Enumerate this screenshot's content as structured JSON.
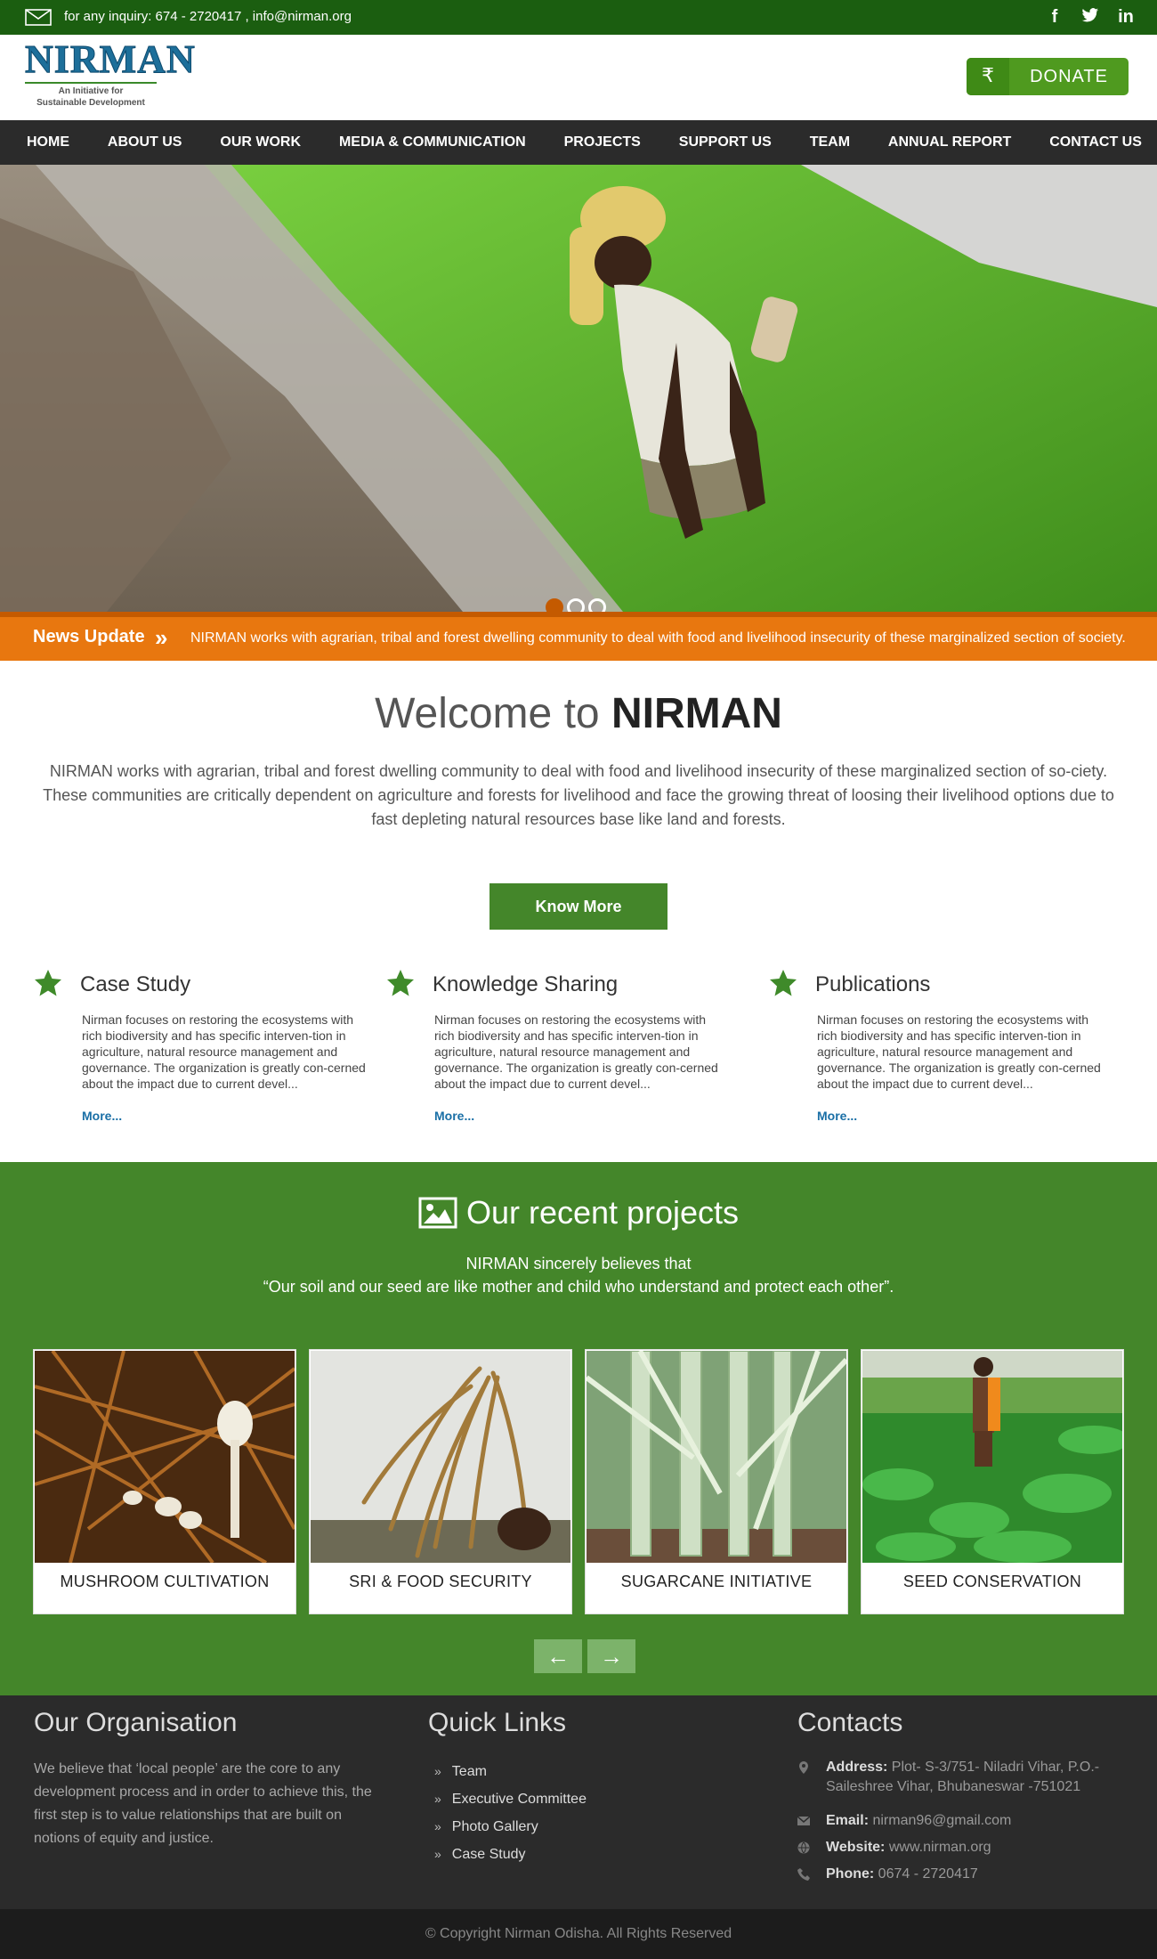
{
  "topbar": {
    "inquiry": "for any inquiry: 674 - 2720417 , info@nirman.org",
    "social": [
      "facebook-icon",
      "twitter-icon",
      "linkedin-icon"
    ]
  },
  "logo": {
    "brand": "NIRMAN",
    "tagline_1": "An Initiative for",
    "tagline_2": "Sustainable Development"
  },
  "donate": {
    "symbol": "₹",
    "label": "DONATE"
  },
  "nav": {
    "items": [
      "HOME",
      "ABOUT US",
      "OUR WORK",
      "MEDIA & COMMUNICATION",
      "PROJECTS",
      "SUPPORT US",
      "TEAM",
      "ANNUAL REPORT",
      "CONTACT US"
    ]
  },
  "hero": {
    "slides": 3,
    "active_slide": 1
  },
  "news": {
    "title": "News Update",
    "ticker": "NIRMAN works with agrarian, tribal and forest dwelling community to deal with food and livelihood insecurity of these marginalized section of society."
  },
  "welcome": {
    "title_prefix": "Welcome to ",
    "title_brand": "NIRMAN",
    "text": "NIRMAN works with agrarian, tribal and forest dwelling community to deal with food and livelihood insecurity of these marginalized section of so-ciety. These communities are critically dependent on agriculture and forests for livelihood and face the growing threat of loosing their livelihood options due to fast depleting natural resources base like land and forests.",
    "button": "Know More"
  },
  "features": [
    {
      "title": "Case Study",
      "text": "Nirman focuses on restoring the ecosystems with rich biodiversity and has specific interven-tion in agriculture, natural resource management and governance. The organization is greatly con-cerned about the impact due to current devel...",
      "more": "More..."
    },
    {
      "title": "Knowledge Sharing",
      "text": "Nirman focuses on restoring the ecosystems with rich biodiversity and has specific interven-tion in agriculture, natural resource management and governance. The organization is greatly con-cerned about the impact due to current devel...",
      "more": "More..."
    },
    {
      "title": "Publications",
      "text": "Nirman focuses on restoring the ecosystems with rich biodiversity and has specific interven-tion in agriculture, natural resource management and governance. The organization is greatly con-cerned about the impact due to current devel...",
      "more": "More..."
    }
  ],
  "projects": {
    "title": "Our recent projects",
    "quote_line1": "NIRMAN sincerely believes that",
    "quote_line2": "“Our soil and our seed are like mother and child who understand and protect each other”.",
    "cards": [
      {
        "label": "MUSHROOM CULTIVATION"
      },
      {
        "label": "SRI & FOOD SECURITY"
      },
      {
        "label": "SUGARCANE INITIATIVE"
      },
      {
        "label": "SEED CONSERVATION"
      }
    ],
    "prev": "←",
    "next": "→"
  },
  "footer": {
    "org_title": "Our Organisation",
    "org_text": "We believe that ‘local people’ are the core to any development process and in order to achieve this, the first step is to value relationships that are built on notions of equity and justice.",
    "links_title": "Quick Links",
    "links": [
      "Team",
      "Executive Committee",
      "Photo Gallery",
      "Case Study"
    ],
    "contacts_title": "Contacts",
    "address_label": "Address:",
    "address": " Plot- S-3/751- Niladri Vihar, P.O.- Saileshree Vihar, Bhubaneswar -751021",
    "email_label": "Email:",
    "email": " nirman96@gmail.com",
    "website_label": "Website:",
    "website": " www.nirman.org",
    "phone_label": "Phone:",
    "phone": " 0674 - 2720417",
    "copyright": "© Copyright Nirman Odisha. All Rights Reserved"
  },
  "colors": {
    "topbar": "#1b5e10",
    "brand_green": "#44862a",
    "news_orange": "#e8770f",
    "footer": "#2b2b2b",
    "link_blue": "#1a6fa6"
  }
}
